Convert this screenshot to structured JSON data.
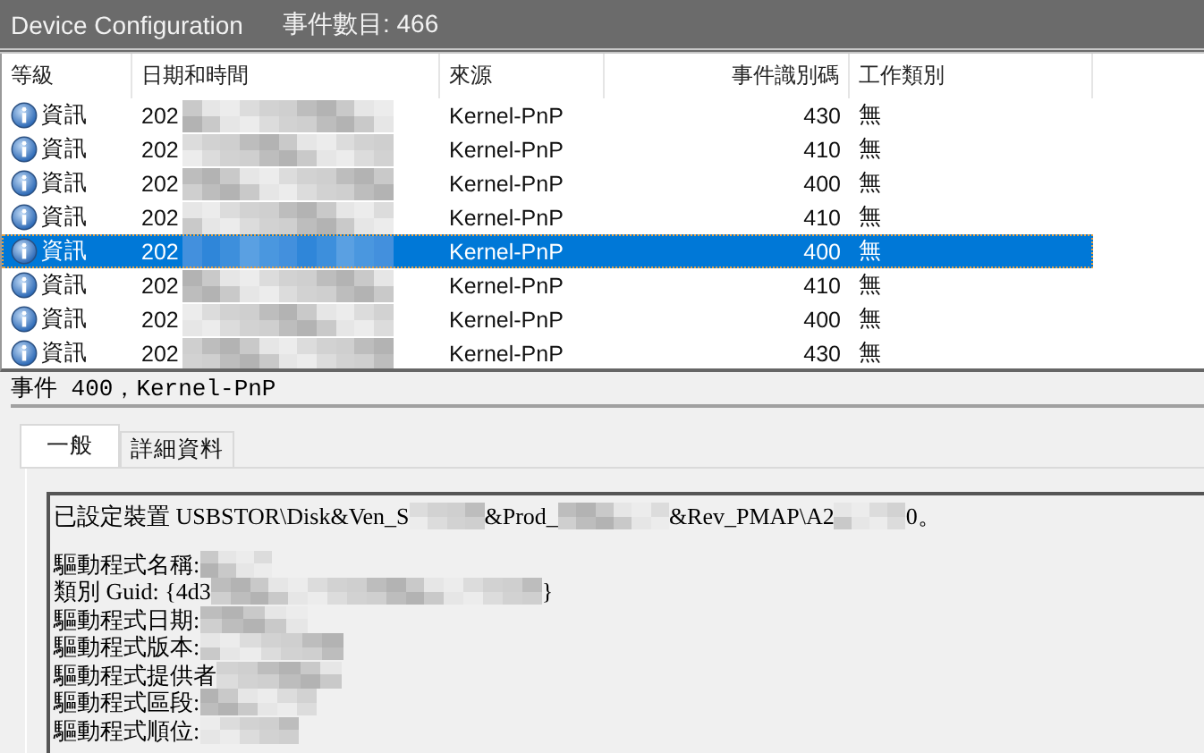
{
  "window": {
    "title": "Device Configuration",
    "event_count": "事件數目: 466"
  },
  "table": {
    "columns": [
      "等級",
      "日期和時間",
      "來源",
      "事件識別碼",
      "工作類別"
    ],
    "rows": [
      {
        "level": "資訊",
        "date": "202",
        "source": "Kernel-PnP",
        "event_id": "430",
        "task": "無",
        "selected": false
      },
      {
        "level": "資訊",
        "date": "202",
        "source": "Kernel-PnP",
        "event_id": "410",
        "task": "無",
        "selected": false
      },
      {
        "level": "資訊",
        "date": "202",
        "source": "Kernel-PnP",
        "event_id": "400",
        "task": "無",
        "selected": false
      },
      {
        "level": "資訊",
        "date": "202",
        "source": "Kernel-PnP",
        "event_id": "410",
        "task": "無",
        "selected": false
      },
      {
        "level": "資訊",
        "date": "202",
        "source": "Kernel-PnP",
        "event_id": "400",
        "task": "無",
        "selected": true
      },
      {
        "level": "資訊",
        "date": "202",
        "source": "Kernel-PnP",
        "event_id": "410",
        "task": "無",
        "selected": false
      },
      {
        "level": "資訊",
        "date": "202",
        "source": "Kernel-PnP",
        "event_id": "400",
        "task": "無",
        "selected": false
      },
      {
        "level": "資訊",
        "date": "202",
        "source": "Kernel-PnP",
        "event_id": "430",
        "task": "無",
        "selected": false
      }
    ]
  },
  "detail": {
    "header": "事件 400，Kernel-PnP",
    "tabs": [
      {
        "label": "一般",
        "selected": true
      },
      {
        "label": "詳細資料",
        "selected": false
      }
    ],
    "paragraphs": [
      [
        {
          "parts": [
            "已設定裝置 USBSTOR\\Disk&Ven_S",
            "&Prod_",
            "&Rev_PMAP\\A2",
            "0。"
          ],
          "redacted_end": false
        }
      ],
      [
        {
          "parts": [
            "驅動程式名稱:"
          ],
          "redacted_end": true
        },
        {
          "parts": [
            "類別 Guid: {4d3",
            "}"
          ],
          "redacted_end": false
        },
        {
          "parts": [
            "驅動程式日期:"
          ],
          "redacted_end": true
        },
        {
          "parts": [
            "驅動程式版本:"
          ],
          "redacted_end": true
        },
        {
          "parts": [
            "驅動程式提供者"
          ],
          "redacted_end": true
        },
        {
          "parts": [
            "驅動程式區段:"
          ],
          "redacted_end": true
        },
        {
          "parts": [
            "驅動程式順位:"
          ],
          "redacted_end": true
        }
      ]
    ]
  }
}
